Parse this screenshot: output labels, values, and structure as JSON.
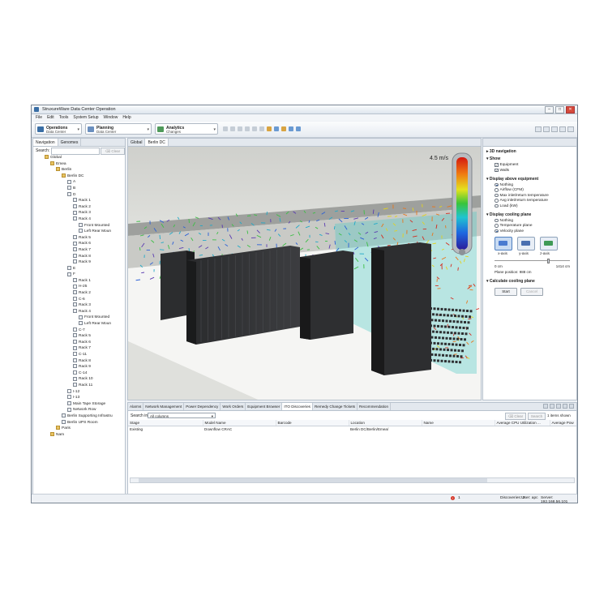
{
  "window": {
    "title": "StruxureWare Data Center Operation"
  },
  "menu": [
    "File",
    "Edit",
    "Tools",
    "System Setup",
    "Window",
    "Help"
  ],
  "perspectives": [
    {
      "title": "Operations",
      "subtitle": "Data Center",
      "color": "#3a6ea5"
    },
    {
      "title": "Planning",
      "subtitle": "Data Center",
      "color": "#6a8fbf"
    },
    {
      "title": "Analytics",
      "subtitle": "Changes",
      "color": "#4f9a5a"
    }
  ],
  "left_panel": {
    "tabs": [
      "Navigation",
      "Genomes"
    ],
    "search_label": "Search:",
    "clear_label": "Clear",
    "tree": [
      {
        "label": "Global",
        "depth": 0,
        "icon": "folder"
      },
      {
        "label": "Emea",
        "depth": 1,
        "icon": "folder"
      },
      {
        "label": "Berlin",
        "depth": 2,
        "icon": "folder"
      },
      {
        "label": "Berlin DC",
        "depth": 3,
        "icon": "folder"
      },
      {
        "label": "A",
        "depth": 4,
        "icon": "rack"
      },
      {
        "label": "B",
        "depth": 4,
        "icon": "rack"
      },
      {
        "label": "D",
        "depth": 4,
        "icon": "rack"
      },
      {
        "label": "Rack 1",
        "depth": 5,
        "icon": "rack"
      },
      {
        "label": "Rack 2",
        "depth": 5,
        "icon": "rack"
      },
      {
        "label": "Rack 3",
        "depth": 5,
        "icon": "rack"
      },
      {
        "label": "Rack 4",
        "depth": 5,
        "icon": "rack"
      },
      {
        "label": "Front Mounted",
        "depth": 6,
        "icon": "rack"
      },
      {
        "label": "Left Rear Moun",
        "depth": 6,
        "icon": "rack"
      },
      {
        "label": "Rack 5",
        "depth": 5,
        "icon": "rack"
      },
      {
        "label": "Rack 6",
        "depth": 5,
        "icon": "rack"
      },
      {
        "label": "Rack 7",
        "depth": 5,
        "icon": "rack"
      },
      {
        "label": "Rack 8",
        "depth": 5,
        "icon": "rack"
      },
      {
        "label": "Rack 9",
        "depth": 5,
        "icon": "rack"
      },
      {
        "label": "E",
        "depth": 4,
        "icon": "rack"
      },
      {
        "label": "F",
        "depth": 4,
        "icon": "rack"
      },
      {
        "label": "Rack 1",
        "depth": 5,
        "icon": "rack"
      },
      {
        "label": "H-25",
        "depth": 5,
        "icon": "ghost"
      },
      {
        "label": "Rack 2",
        "depth": 5,
        "icon": "rack"
      },
      {
        "label": "C-6",
        "depth": 5,
        "icon": "ghost"
      },
      {
        "label": "Rack 3",
        "depth": 5,
        "icon": "rack"
      },
      {
        "label": "Rack 4",
        "depth": 5,
        "icon": "rack"
      },
      {
        "label": "Front Mounted",
        "depth": 6,
        "icon": "rack"
      },
      {
        "label": "Left Rear Moun",
        "depth": 6,
        "icon": "rack"
      },
      {
        "label": "C-7",
        "depth": 5,
        "icon": "ghost"
      },
      {
        "label": "Rack 5",
        "depth": 5,
        "icon": "rack"
      },
      {
        "label": "Rack 6",
        "depth": 5,
        "icon": "rack"
      },
      {
        "label": "Rack 7",
        "depth": 5,
        "icon": "rack"
      },
      {
        "label": "C-11",
        "depth": 5,
        "icon": "ghost"
      },
      {
        "label": "Rack 8",
        "depth": 5,
        "icon": "rack"
      },
      {
        "label": "Rack 9",
        "depth": 5,
        "icon": "rack"
      },
      {
        "label": "C-14",
        "depth": 5,
        "icon": "ghost"
      },
      {
        "label": "Rack 10",
        "depth": 5,
        "icon": "rack"
      },
      {
        "label": "Rack 11",
        "depth": 5,
        "icon": "rack"
      },
      {
        "label": "I-12",
        "depth": 4,
        "icon": "ghost"
      },
      {
        "label": "I-13",
        "depth": 4,
        "icon": "ghost"
      },
      {
        "label": "Main Tape Storage",
        "depth": 4,
        "icon": "rack"
      },
      {
        "label": "Network Row",
        "depth": 4,
        "icon": "rack"
      },
      {
        "label": "Berlin Supporting Infrastru",
        "depth": 3,
        "icon": "rack"
      },
      {
        "label": "Berlin UPS Room",
        "depth": 3,
        "icon": "rack"
      },
      {
        "label": "Paris",
        "depth": 2,
        "icon": "folder"
      },
      {
        "label": "Nam",
        "depth": 1,
        "icon": "folder"
      }
    ]
  },
  "center": {
    "tabs": [
      "Global",
      "Berlin DC"
    ],
    "colorbar_max": "4.5 m/s"
  },
  "right_panel": {
    "sections": {
      "nav3d": "3D navigation",
      "show": "Show",
      "display_above": "Display above equipment",
      "cooling_plane": "Display cooling plane",
      "calc": "Calculate cooling plane"
    },
    "show_options": [
      {
        "label": "Equipment",
        "checked": true
      },
      {
        "label": "Walls",
        "checked": true
      }
    ],
    "above_options": [
      {
        "label": "Nothing",
        "selected": true
      },
      {
        "label": "Airflow (CFM)",
        "selected": false
      },
      {
        "label": "Max inlet/return temperature",
        "selected": false
      },
      {
        "label": "Avg inlet/return temperature",
        "selected": false
      },
      {
        "label": "Load (kW)",
        "selected": false
      }
    ],
    "plane_options": [
      {
        "label": "Nothing",
        "selected": false
      },
      {
        "label": "Temperature plane",
        "selected": false
      },
      {
        "label": "Velocity plane",
        "selected": true
      }
    ],
    "axes": [
      {
        "label": "x-axis",
        "selected": true,
        "color": "#4a7bd0"
      },
      {
        "label": "y-axis",
        "selected": false,
        "color": "#4a6fb0"
      },
      {
        "label": "z-axis",
        "selected": false,
        "color": "#3f9a56"
      }
    ],
    "range_min": "0 cm",
    "range_max": "1414 cm",
    "plane_position_label": "Plane position:",
    "plane_position_value": "988 cm",
    "plane_position_fraction": 0.7,
    "start_label": "Start",
    "cancel_label": "Cancel"
  },
  "bottom": {
    "tabs": [
      "Alarms",
      "Network Management",
      "Power Dependency",
      "Work Orders",
      "Equipment Browser",
      "ITO Discoveries",
      "Remedy Change Tickets",
      "Recommendation"
    ],
    "active_tab": 5,
    "search_in_label": "Search in:",
    "search_in_value": "All columns",
    "clear_label": "Clear",
    "search_label": "Search",
    "items_count": "1 items shown",
    "columns": [
      "Stage",
      "Model Name",
      "Barcode",
      "Location",
      "Name",
      "Average CPU Utilization ...",
      "Average Pow"
    ],
    "rows": [
      [
        "Existing",
        "Downflow CRAC",
        "",
        "Berlin DC/Berlin/Emea/",
        "",
        "",
        ""
      ]
    ]
  },
  "status": {
    "errors": "1",
    "discoveries": "Discoveries: 3",
    "user": "User: apc",
    "server": "Server: 192.168.56.101"
  }
}
